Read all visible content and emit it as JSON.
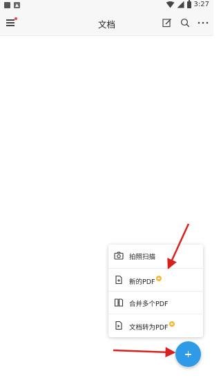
{
  "status_bar": {
    "time": "3:27"
  },
  "header": {
    "title": "文档"
  },
  "popup_menu": {
    "items": [
      {
        "label": "拍照扫描",
        "icon": "camera-icon",
        "premium": false
      },
      {
        "label": "新的PDF",
        "icon": "new-pdf-icon",
        "premium": true
      },
      {
        "label": "合并多个PDF",
        "icon": "merge-pdf-icon",
        "premium": false
      },
      {
        "label": "文档转为PDF",
        "icon": "convert-pdf-icon",
        "premium": true
      }
    ]
  },
  "fab": {
    "icon": "plus-icon"
  },
  "colors": {
    "fab": "#2f9be6",
    "arrow": "#d9201f",
    "badge": "#f5b82e",
    "notification_dot": "#f0454a"
  }
}
